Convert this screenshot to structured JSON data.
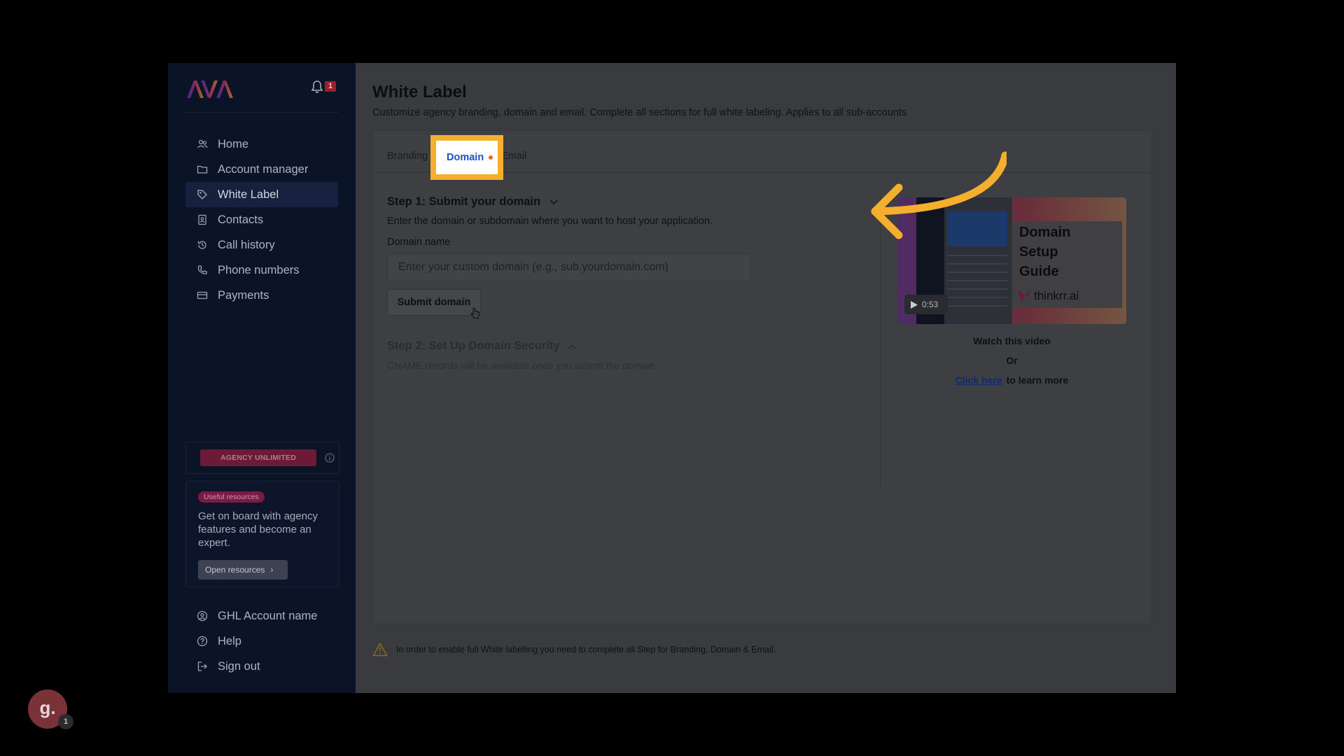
{
  "app": {
    "logo_text": "AVA",
    "notification_count": "1"
  },
  "sidebar": {
    "items": [
      {
        "label": "Home",
        "icon": "users-icon"
      },
      {
        "label": "Account manager",
        "icon": "folder-icon"
      },
      {
        "label": "White Label",
        "icon": "tag-icon",
        "active": true
      },
      {
        "label": "Contacts",
        "icon": "contact-book-icon"
      },
      {
        "label": "Call history",
        "icon": "history-icon"
      },
      {
        "label": "Phone numbers",
        "icon": "phone-icon"
      },
      {
        "label": "Payments",
        "icon": "card-icon"
      }
    ],
    "plan_label": "AGENCY UNLIMITED",
    "resources": {
      "tag": "Useful resources",
      "text": "Get on board with agency features and become an expert.",
      "button": "Open resources"
    },
    "bottom_items": [
      {
        "label": "GHL Account name",
        "icon": "user-circle-icon"
      },
      {
        "label": "Help",
        "icon": "help-icon"
      },
      {
        "label": "Sign out",
        "icon": "sign-out-icon"
      }
    ]
  },
  "main": {
    "title": "White Label",
    "subtitle": "Customize agency branding, domain and email. Complete all sections for full white labeling. Applies to all sub-accounts",
    "tabs": {
      "branding": "Branding",
      "domain": "Domain",
      "email": "Email"
    },
    "step1": {
      "title": "Step 1: Submit your domain",
      "description": "Enter the domain or subdomain where you want to host your application.",
      "field_label": "Domain name",
      "placeholder": "Enter your custom domain (e.g., sub.yourdomain.com)",
      "value": "",
      "submit": "Submit domain"
    },
    "step2": {
      "title": "Step 2: Set Up Domain Security",
      "description": "CNAME records will be available once you submit the domain."
    },
    "video": {
      "title_line1": "Domain",
      "title_line2": "Setup",
      "title_line3": "Guide",
      "brand": "thinkrr.ai",
      "duration": "0:53",
      "watch": "Watch this video",
      "or": "Or",
      "click_here": "Click here",
      "learn_more": "to learn more"
    },
    "warning": "In order to enable full White labelling you need to complete all Step for Branding, Domain & Email."
  },
  "widget": {
    "letter": "g.",
    "badge": "1"
  },
  "colors": {
    "highlight": "#f6ae2d",
    "active_tab_text": "#1e4fc7",
    "unsaved_dot": "#e8692a",
    "plan_pill": "#6d1a36",
    "sidebar_bg": "#0b1327"
  }
}
